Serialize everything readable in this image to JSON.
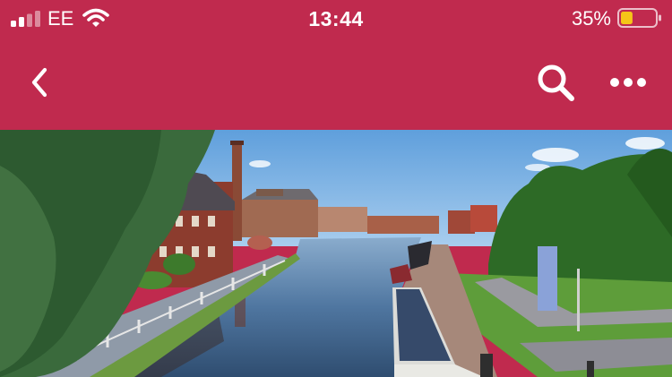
{
  "status_bar": {
    "carrier": "EE",
    "time": "13:44",
    "battery_percent": "35%",
    "battery_level": 0.35,
    "signal_bars": 2,
    "icons": [
      "signal-icon",
      "wifi-icon",
      "battery-icon"
    ]
  },
  "nav_bar": {
    "background_color": "#c02a4e",
    "icons": [
      "back-chevron-icon",
      "search-icon",
      "more-dots-icon"
    ]
  },
  "photo": {
    "subject": "canal-scene-image"
  }
}
